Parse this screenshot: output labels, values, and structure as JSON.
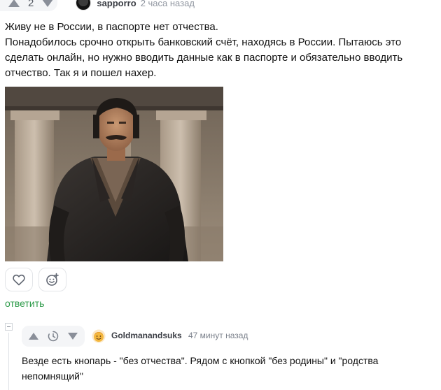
{
  "comment": {
    "votes": "2",
    "author": "sapporro",
    "time": "2 часа назад",
    "paragraphs": [
      "Живу не в России, в паспорте нет отчества.",
      "Понадобилось срочно открыть банковский счёт, находясь в России. Пытаюсь это сделать онлайн, но нужно вводить данные как в паспорте и обязательно вводить отчество. Так я и пошел нахер."
    ],
    "reply_label": "ответить",
    "icons": {
      "upvote": "arrow-up-icon",
      "downvote": "arrow-down-icon",
      "like": "heart-icon",
      "react": "emoji-add-icon"
    }
  },
  "reply": {
    "author": "Goldmanandsuks",
    "time": "47 минут назад",
    "text": "Везде есть кнопарь - \"без отчества\". Рядом с кнопкой \"без родины\" и \"родства непомнящий\"",
    "icons": {
      "upvote": "arrow-up-icon",
      "pending": "clock-icon",
      "downvote": "arrow-down-icon",
      "avatar": "smiley-avatar-icon"
    }
  },
  "colors": {
    "accent_green": "#2e9b4a",
    "vote_bg": "#f4f5f7",
    "muted_text": "#9096a0"
  }
}
